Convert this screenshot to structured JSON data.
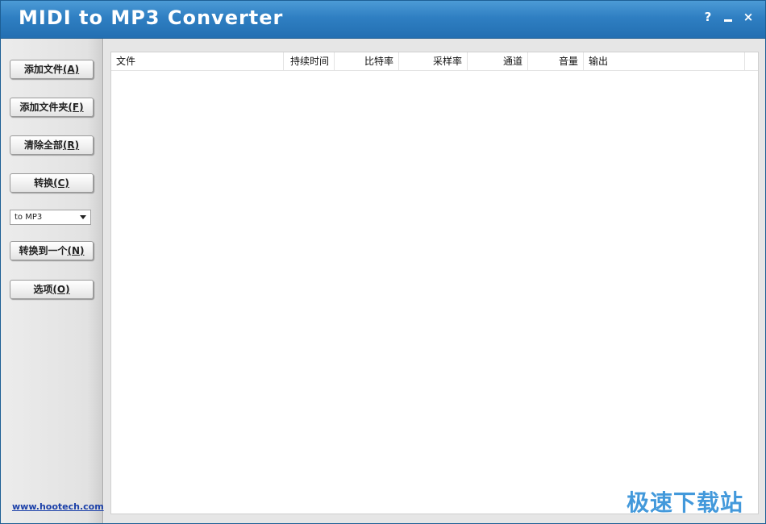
{
  "window": {
    "title": "MIDI to MP3 Converter",
    "help_label": "?",
    "close_label": "×"
  },
  "sidebar": {
    "buttons": [
      {
        "label": "添加文件",
        "hotkey": "(A)"
      },
      {
        "label": "添加文件夹",
        "hotkey": "(F)"
      },
      {
        "label": "清除全部",
        "hotkey": "(R)"
      },
      {
        "label": "转换",
        "hotkey": "(C)"
      },
      {
        "label": "转换到一个",
        "hotkey": "(N)"
      },
      {
        "label": "选项",
        "hotkey": "(O)"
      }
    ],
    "format_select": {
      "value": "to MP3"
    },
    "website_link": "www.hootech.com"
  },
  "filelist": {
    "columns": [
      "文件",
      "持续时间",
      "比特率",
      "采样率",
      "通道",
      "音量",
      "输出"
    ],
    "rows": []
  },
  "watermark": "极速下载站",
  "colors": {
    "titlebar": "#2f7fc2",
    "link": "#1a3fa8",
    "watermark": "#2f8fd8"
  }
}
